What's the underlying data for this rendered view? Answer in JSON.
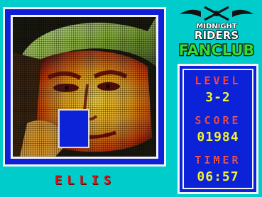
{
  "game": {
    "character_name": "ELLIS",
    "logo": {
      "line1": "MIDNIGHT",
      "line2": "RIDERS",
      "line3": "FANCLUB"
    },
    "stats": {
      "level_label": "LEVEL",
      "level_value": "3-2",
      "score_label": "SCORE",
      "score_value": "01984",
      "timer_label": "TIMER",
      "timer_value": "06:57"
    },
    "colors": {
      "background": "#00cccc",
      "panel_blue": "#0b22d8",
      "label_red": "#ff3322",
      "value_yellow": "#f2f233",
      "logo_green": "#33dd33"
    }
  }
}
